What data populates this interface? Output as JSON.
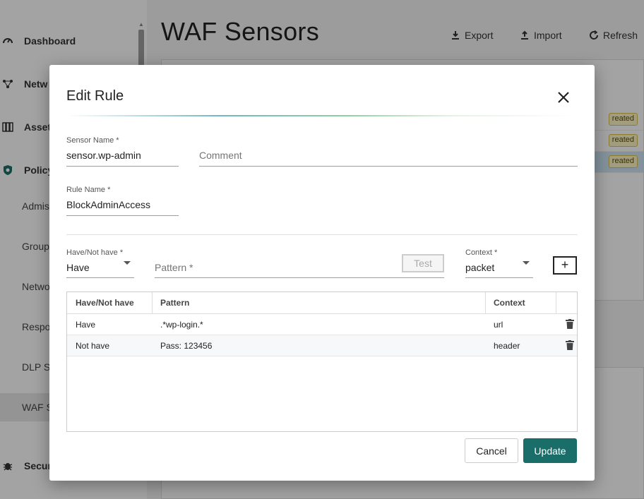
{
  "sidebar": {
    "items": [
      {
        "label": "Dashboard",
        "icon": "gauge-icon"
      },
      {
        "label": "Netw",
        "icon": "network-icon"
      },
      {
        "label": "Asset",
        "icon": "assets-icon"
      },
      {
        "label": "Policy",
        "icon": "shield-icon"
      },
      {
        "label": "Admis"
      },
      {
        "label": "Group"
      },
      {
        "label": "Netwo"
      },
      {
        "label": "Respo"
      },
      {
        "label": "DLP S"
      },
      {
        "label": "WAF S"
      },
      {
        "label": "Secur",
        "icon": "bug-icon"
      }
    ]
  },
  "page": {
    "title": "WAF Sensors",
    "toolbar": {
      "export": "Export",
      "import": "Import",
      "refresh": "Refresh"
    },
    "badges": [
      "reated",
      "reated",
      "reated"
    ]
  },
  "dialog": {
    "title": "Edit Rule",
    "sensor_name": {
      "label": "Sensor Name *",
      "value": "sensor.wp-admin"
    },
    "comment": {
      "placeholder": "Comment"
    },
    "rule_name": {
      "label": "Rule Name *",
      "value": "BlockAdminAccess"
    },
    "have_not_have": {
      "label": "Have/Not have *",
      "value": "Have"
    },
    "pattern": {
      "placeholder": "Pattern *"
    },
    "test_label": "Test",
    "context": {
      "label": "Context *",
      "value": "packet"
    },
    "add_label": "+",
    "table": {
      "headers": [
        "Have/Not have",
        "Pattern",
        "Context"
      ],
      "rows": [
        {
          "have": "Have",
          "pattern": ".*wp-login.*",
          "context": "url"
        },
        {
          "have": "Not have",
          "pattern": "Pass: 123456",
          "context": "header"
        }
      ]
    },
    "cancel_label": "Cancel",
    "update_label": "Update",
    "accent_color": "#1a6e6a"
  }
}
